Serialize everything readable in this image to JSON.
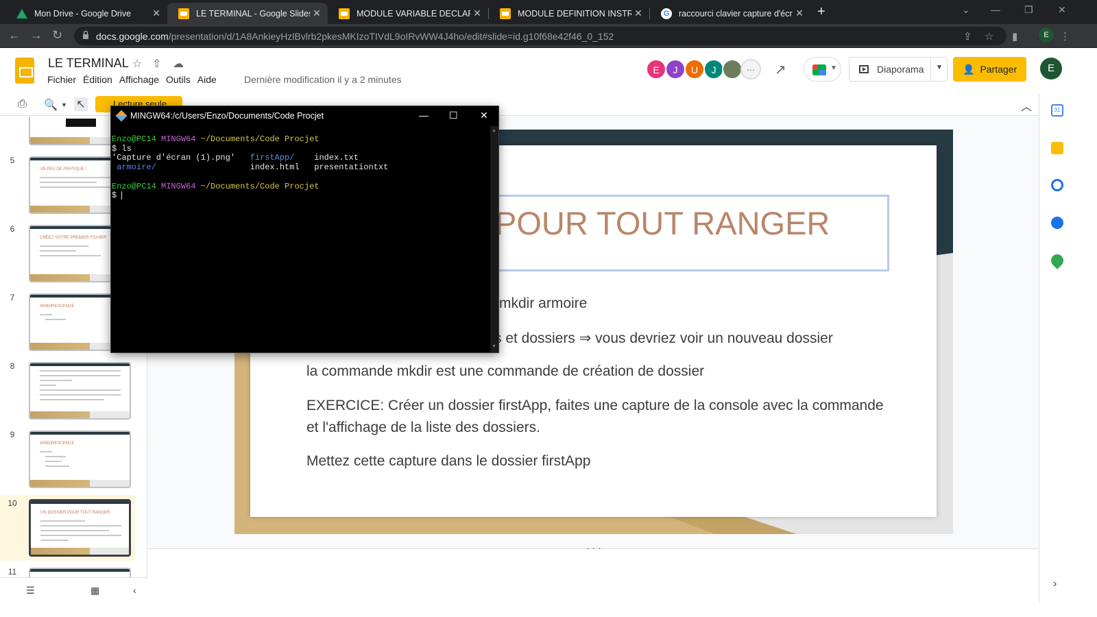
{
  "browser": {
    "tabs": [
      {
        "title": "Mon Drive - Google Drive",
        "icon": "drive-icon"
      },
      {
        "title": "LE TERMINAL - Google Slides",
        "icon": "slides-icon"
      },
      {
        "title": "MODULE VARIABLE DECLARATIO",
        "icon": "slides-icon"
      },
      {
        "title": "MODULE DEFINITION INSTRUCTI",
        "icon": "slides-icon"
      },
      {
        "title": "raccourci clavier capture d'écran",
        "icon": "google-icon"
      }
    ],
    "active_tab": 1,
    "url_host": "docs.google.com",
    "url_path": "/presentation/d/1A8AnkieyHzlBvlrb2pkesMKIzoTIVdL9oIRvWW4J4ho/edit#slide=id.g10f68e42f46_0_152",
    "profile_initial": "E"
  },
  "docs": {
    "title": "LE TERMINAL",
    "menu": [
      "Fichier",
      "Édition",
      "Affichage",
      "Outils",
      "Aide"
    ],
    "last_edit": "Dernière modification il y a 2 minutes",
    "collaborators": [
      {
        "initial": "E",
        "color": "#e8337a"
      },
      {
        "initial": "J",
        "color": "#8e44c8"
      },
      {
        "initial": "U",
        "color": "#ef6c00"
      },
      {
        "initial": "J",
        "color": "#00897b"
      }
    ],
    "present_label": "Diaporama",
    "share_label": "Partager",
    "account_initial": "E",
    "readonly_label": "Lecture seule"
  },
  "filmstrip": {
    "slides": [
      {
        "num": "5",
        "title": "UN PEU DE PRATIQUE !"
      },
      {
        "num": "6",
        "title": "CRÉEZ VOTRE PREMIER FICHIER"
      },
      {
        "num": "7",
        "title": "ARBORESCENCE"
      },
      {
        "num": "8",
        "title": ""
      },
      {
        "num": "9",
        "title": "ARBORESCENCE"
      },
      {
        "num": "10",
        "title": "UN DOSSIER POUR TOUT RANGER"
      },
      {
        "num": "11",
        "title": ""
      }
    ],
    "selected": "10"
  },
  "slide": {
    "title": "POUR TOUT RANGER",
    "lines": [
      "mkdir armoire",
      "rs et dossiers ⇒ vous devriez voir un nouveau dossier",
      "la commande mkdir est une commande de création de dossier",
      "EXERCICE: Créer un dossier firstApp, faites une capture de la console avec la commande",
      "et l'affichage de la liste des dossiers.",
      "Mettez cette capture dans le dossier firstApp"
    ]
  },
  "terminal": {
    "title": "MINGW64:/c/Users/Enzo/Documents/Code Procjet",
    "prompt_user": "Enzo@PC14",
    "prompt_env": "MINGW64",
    "prompt_path": "~/Documents/Code Procjet",
    "command": "$ ls",
    "ls_col1": [
      "'Capture d'écran (1).png'",
      " armoire/"
    ],
    "ls_col2": [
      "firstApp/",
      "index.html"
    ],
    "ls_col3": [
      "index.txt",
      "presentationtxt"
    ],
    "prompt_char": "$ "
  },
  "colors": {
    "accent": "#fbbc04",
    "slide_title": "#b8866a",
    "slide_dark": "#263a44",
    "slide_gold": "#c4a366"
  }
}
